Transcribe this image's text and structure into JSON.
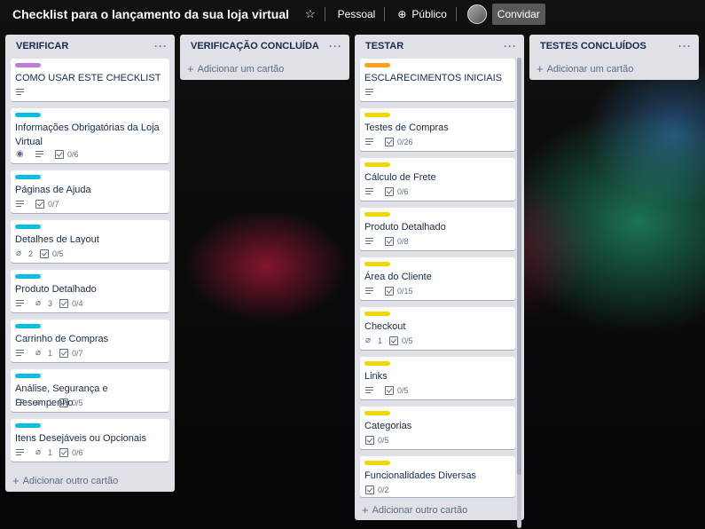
{
  "board": {
    "title": "Checklist para o lançamento da sua loja virtual",
    "visibility_team": "Pessoal",
    "visibility_public": "Público",
    "invite_label": "Convidar"
  },
  "colors": {
    "purple": "#c377e0",
    "cyan": "#00c2e0",
    "orange": "#ff9f1a",
    "yellow": "#f2d600"
  },
  "lists": [
    {
      "title": "VERIFICAR",
      "add_label": "Adicionar outro cartão",
      "cards": [
        {
          "label": "purple",
          "title": "COMO USAR ESTE CHECKLIST",
          "desc": true
        },
        {
          "label": "cyan",
          "title": "Informações Obrigatórias da Loja Virtual",
          "watch": true,
          "desc": true,
          "checklist": "0/6"
        },
        {
          "label": "cyan",
          "title": "Páginas de Ajuda",
          "desc": true,
          "checklist": "0/7"
        },
        {
          "label": "cyan",
          "title": "Detalhes de Layout",
          "attachments": "2",
          "checklist": "0/5"
        },
        {
          "label": "cyan",
          "title": "Produto Detalhado",
          "desc": true,
          "attachments": "3",
          "checklist": "0/4"
        },
        {
          "label": "cyan",
          "title": "Carrinho de Compras",
          "desc": true,
          "attachments": "1",
          "checklist": "0/7"
        },
        {
          "label": "cyan",
          "title": "Análise, Segurança e Desempenho",
          "desc": true,
          "attachments": "1",
          "checklist": "0/5"
        },
        {
          "label": "cyan",
          "title": "Itens Desejáveis ou Opcionais",
          "desc": true,
          "attachments": "1",
          "checklist": "0/6"
        }
      ]
    },
    {
      "title": "VERIFICAÇÃO CONCLUÍDA",
      "add_label": "Adicionar um cartão",
      "cards": []
    },
    {
      "title": "TESTAR",
      "add_label": "Adicionar outro cartão",
      "cards": [
        {
          "label": "orange",
          "title": "ESCLARECIMENTOS INICIAIS",
          "desc": true
        },
        {
          "label": "yellow",
          "title": "Testes de Compras",
          "desc": true,
          "checklist": "0/26"
        },
        {
          "label": "yellow",
          "title": "Cálculo de Frete",
          "desc": true,
          "checklist": "0/6"
        },
        {
          "label": "yellow",
          "title": "Produto Detalhado",
          "desc": true,
          "checklist": "0/8"
        },
        {
          "label": "yellow",
          "title": "Área do Cliente",
          "desc": true,
          "checklist": "0/15"
        },
        {
          "label": "yellow",
          "title": "Checkout",
          "attachments": "1",
          "checklist": "0/5"
        },
        {
          "label": "yellow",
          "title": "Links",
          "desc": true,
          "checklist": "0/5"
        },
        {
          "label": "yellow",
          "title": "Categorias",
          "checklist": "0/5"
        },
        {
          "label": "yellow",
          "title": "Funcionalidades Diversas",
          "checklist": "0/2"
        }
      ]
    },
    {
      "title": "TESTES CONCLUÍDOS",
      "add_label": "Adicionar um cartão",
      "cards": []
    }
  ]
}
